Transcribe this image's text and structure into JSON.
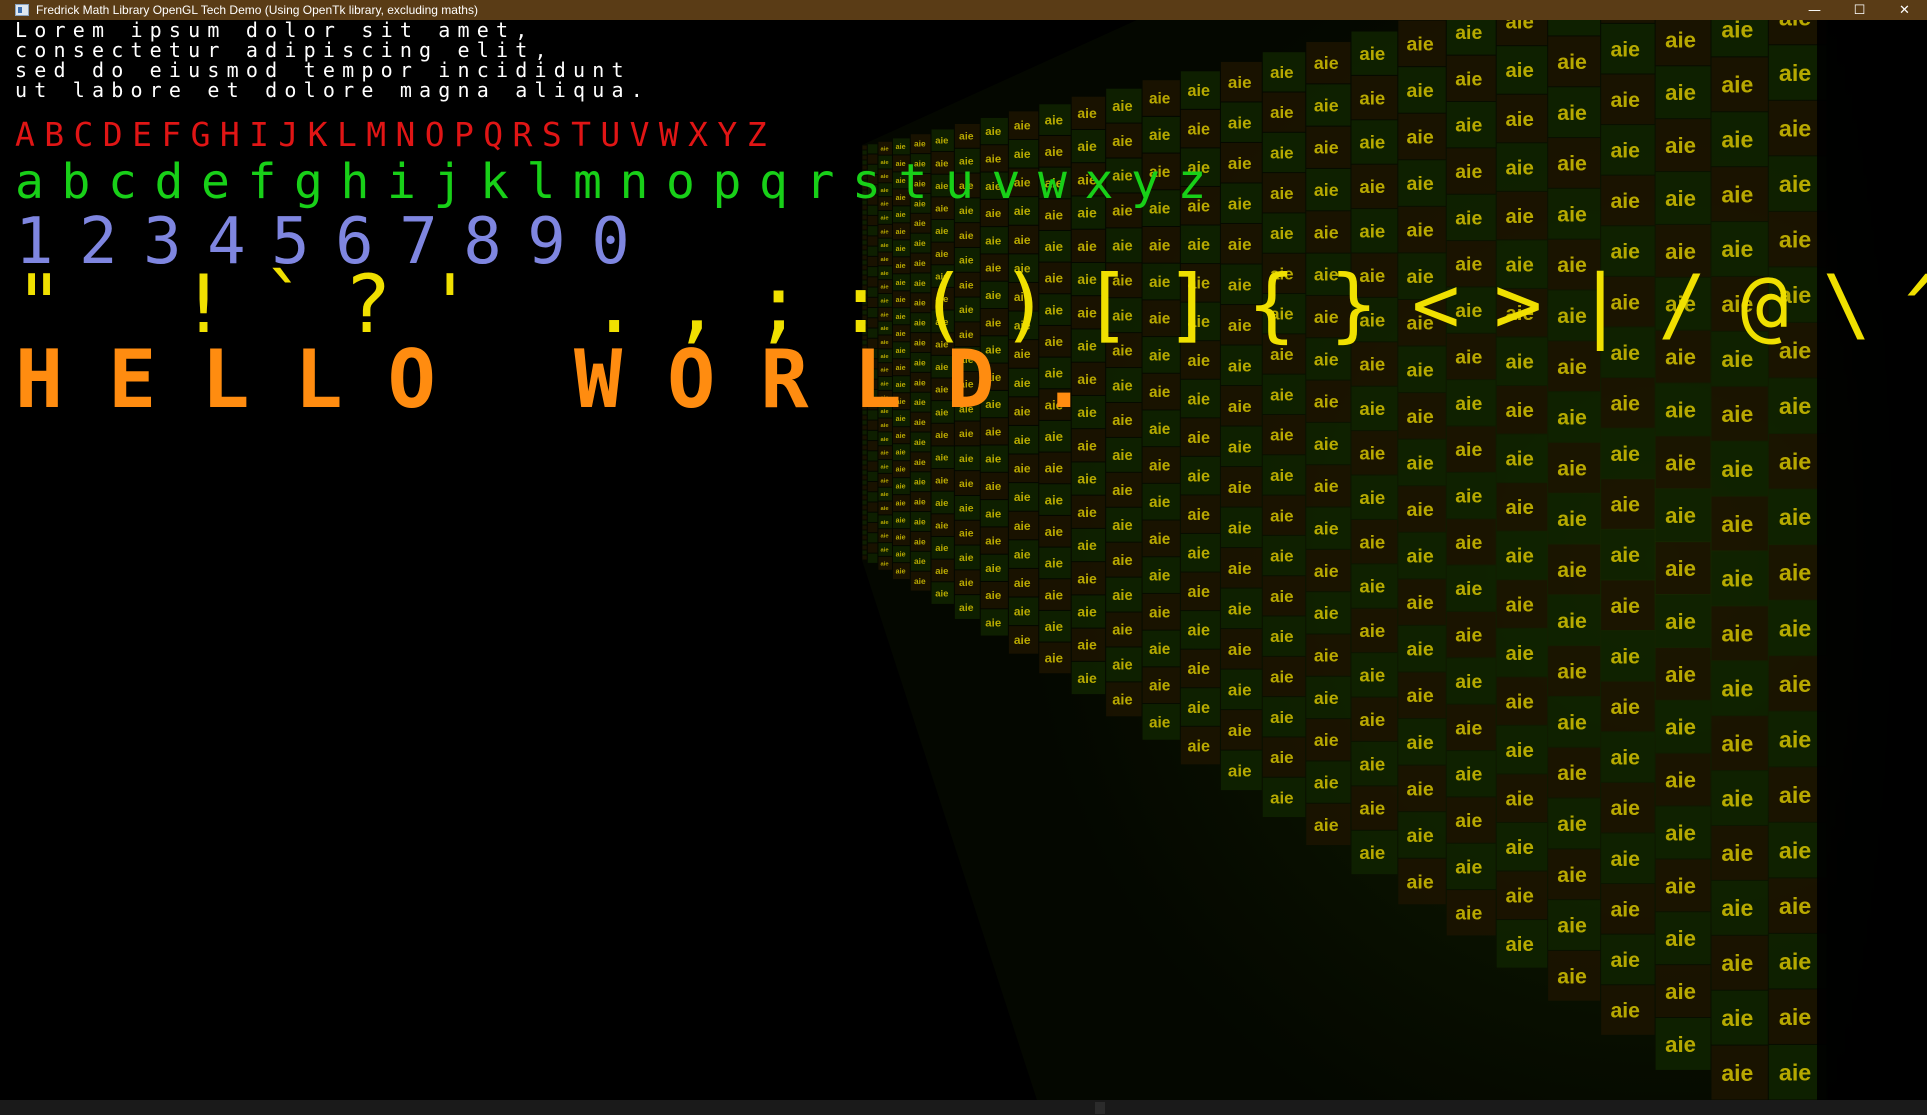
{
  "window": {
    "title": "Fredrick Math Library OpenGL Tech Demo (Using OpenTk library, excluding maths)",
    "minimize_glyph": "—",
    "maximize_glyph": "☐",
    "close_glyph": "✕"
  },
  "scene": {
    "tile_text": "aie",
    "tile_color": "#d4c200",
    "wall_tint": "#1a3a00"
  },
  "overlay": {
    "lorem": [
      "Lorem ipsum dolor sit amet,",
      "consectetur adipiscing elit,",
      "sed do eiusmod tempor incididunt",
      "ut labore et dolore magna aliqua."
    ],
    "uppercase": "ABCDEFGHIJKLMNOPQRSTUVWXYZ",
    "lowercase": "abcdefghijklmnopqrstuvwxyz",
    "digits": "1234567890",
    "symbols": "\" !`?' .,;:()[]{}<>|/@\\^ &-$",
    "hello": "HELLO WORLD."
  },
  "colors": {
    "lorem": "#ffffff",
    "uppercase": "#e01515",
    "lowercase": "#18d018",
    "digits": "#7f86e0",
    "symbols": "#f0e000",
    "hello": "#ff8c10"
  }
}
